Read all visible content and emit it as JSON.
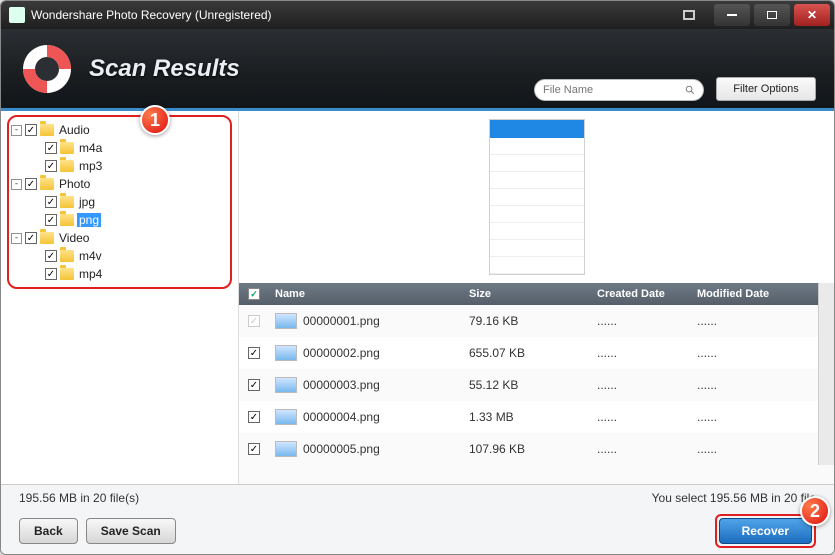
{
  "window": {
    "title": "Wondershare Photo Recovery (Unregistered)"
  },
  "header": {
    "title": "Scan Results",
    "search_placeholder": "File Name",
    "filter_label": "Filter Options"
  },
  "tree": {
    "nodes": [
      {
        "label": "Audio",
        "children": [
          "m4a",
          "mp3"
        ]
      },
      {
        "label": "Photo",
        "children": [
          "jpg",
          "png"
        ],
        "selected_child": "png"
      },
      {
        "label": "Video",
        "children": [
          "m4v",
          "mp4"
        ]
      }
    ]
  },
  "columns": {
    "name": "Name",
    "size": "Size",
    "created": "Created Date",
    "modified": "Modified Date"
  },
  "files": [
    {
      "name": "00000001.png",
      "size": "79.16 KB",
      "created": "......",
      "modified": "......",
      "checked": true,
      "disabled": true
    },
    {
      "name": "00000002.png",
      "size": "655.07 KB",
      "created": "......",
      "modified": "......",
      "checked": true,
      "disabled": false
    },
    {
      "name": "00000003.png",
      "size": "55.12 KB",
      "created": "......",
      "modified": "......",
      "checked": true,
      "disabled": false
    },
    {
      "name": "00000004.png",
      "size": "1.33 MB",
      "created": "......",
      "modified": "......",
      "checked": true,
      "disabled": false
    },
    {
      "name": "00000005.png",
      "size": "107.96 KB",
      "created": "......",
      "modified": "......",
      "checked": true,
      "disabled": false
    }
  ],
  "status": {
    "left": "195.56 MB in 20 file(s)",
    "right": "You select 195.56 MB in 20 file"
  },
  "buttons": {
    "back": "Back",
    "save_scan": "Save Scan",
    "recover": "Recover"
  },
  "badges": {
    "b1": "1",
    "b2": "2"
  }
}
